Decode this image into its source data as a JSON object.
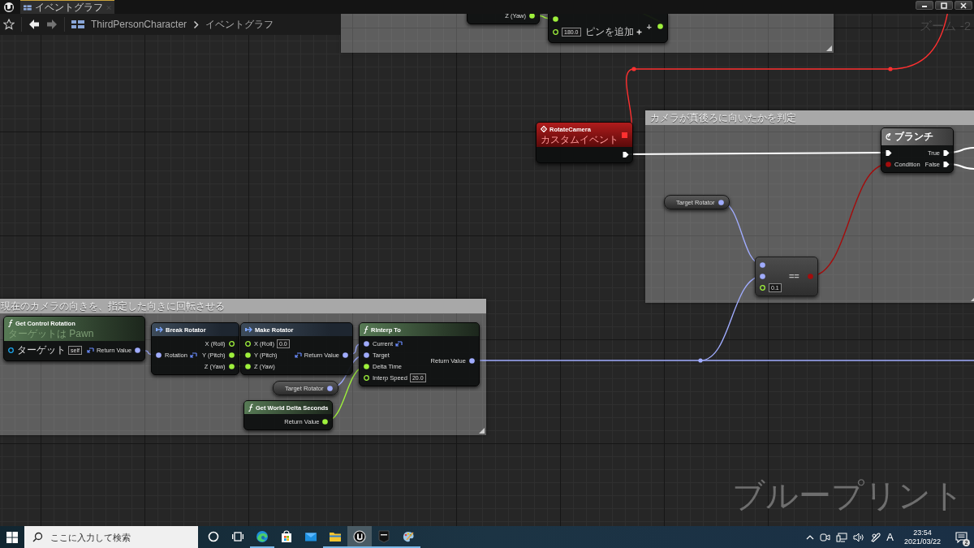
{
  "window": {
    "tab": {
      "title": "イベントグラフ",
      "selected": true
    }
  },
  "toolbar": {
    "nav": [
      {
        "kind": "back",
        "disabled": false
      },
      {
        "kind": "forward",
        "disabled": true
      }
    ],
    "breadcrumb": [
      {
        "label": "ThirdPersonCharacter"
      },
      {
        "label": "イベントグラフ"
      }
    ]
  },
  "graph": {
    "zoom_label": "ズーム -2",
    "watermark": "ブループリント",
    "comments": [
      {
        "kind": "plain"
      },
      {
        "kind": "titled",
        "title": "カメラが真後ろに向いたかを判定"
      },
      {
        "kind": "titled",
        "title": "現在のカメラの向きを、指定した向きに回転させる"
      }
    ],
    "nodes": [
      {
        "kind": "partial",
        "outputs": [
          {
            "label": "Z (Yaw)",
            "kind": "float",
            "connected": true
          }
        ]
      },
      {
        "kind": "partial",
        "symbol": "+",
        "add_pin": "ピンを追加",
        "inputs": [
          {
            "kind": "float",
            "connected": true
          },
          {
            "kind": "float",
            "connected": false,
            "value": "180.0"
          }
        ],
        "outputs": [
          {
            "kind": "float",
            "connected": true
          }
        ]
      },
      {
        "kind": "event",
        "title": "RotateCamera",
        "subtitle": "カスタムイベント",
        "outputs": [
          {
            "kind": "delegate",
            "connected": true
          },
          {
            "kind": "exec",
            "connected": true
          }
        ]
      },
      {
        "kind": "branch",
        "title": "ブランチ",
        "inputs": [
          {
            "kind": "exec",
            "connected": true
          },
          {
            "label": "Condition",
            "kind": "bool",
            "connected": true
          }
        ],
        "outputs": [
          {
            "label": "True",
            "kind": "exec",
            "connected": true
          },
          {
            "label": "False",
            "kind": "exec",
            "connected": true
          }
        ]
      },
      {
        "kind": "variable",
        "outputs": [
          {
            "label": "Target Rotator",
            "kind": "rotator",
            "connected": true
          }
        ]
      },
      {
        "kind": "operator",
        "symbol": "==",
        "inputs": [
          {
            "kind": "rotator",
            "connected": true
          },
          {
            "kind": "rotator",
            "connected": true
          },
          {
            "kind": "float",
            "connected": false,
            "value": "0.1"
          }
        ],
        "outputs": [
          {
            "kind": "bool",
            "connected": true
          }
        ]
      },
      {
        "kind": "function",
        "title": "Get Control Rotation",
        "subtitle": "ターゲットは Pawn",
        "inputs": [
          {
            "label": "ターゲット",
            "kind": "object",
            "connected": false,
            "value": "self"
          }
        ],
        "outputs": [
          {
            "label": "Return Value",
            "kind": "rotator",
            "connected": true,
            "split": true
          }
        ]
      },
      {
        "kind": "struct",
        "title": "Break Rotator",
        "inputs": [
          {
            "label": "Rotation",
            "kind": "rotator",
            "connected": true,
            "split": true
          }
        ],
        "outputs": [
          {
            "label": "X (Roll)",
            "kind": "float",
            "connected": false
          },
          {
            "label": "Y (Pitch)",
            "kind": "float",
            "connected": true
          },
          {
            "label": "Z (Yaw)",
            "kind": "float",
            "connected": true
          }
        ]
      },
      {
        "kind": "struct",
        "title": "Make Rotator",
        "inputs": [
          {
            "label": "X (Roll)",
            "kind": "float",
            "connected": false,
            "value": "0.0"
          },
          {
            "label": "Y (Pitch)",
            "kind": "float",
            "connected": true
          },
          {
            "label": "Z (Yaw)",
            "kind": "float",
            "connected": true
          }
        ],
        "outputs": [
          {
            "label": "Return Value",
            "kind": "rotator",
            "connected": true,
            "split": true
          }
        ]
      },
      {
        "kind": "function",
        "title": "RInterp To",
        "inputs": [
          {
            "label": "Current",
            "kind": "rotator",
            "connected": true,
            "split": true
          },
          {
            "label": "Target",
            "kind": "rotator",
            "connected": true
          },
          {
            "label": "Delta Time",
            "kind": "float",
            "connected": true
          },
          {
            "label": "Interp Speed",
            "kind": "float",
            "connected": false,
            "value": "20.0"
          }
        ],
        "outputs": [
          {
            "label": "Return Value",
            "kind": "rotator",
            "connected": true
          }
        ]
      },
      {
        "kind": "variable",
        "outputs": [
          {
            "label": "Target Rotator",
            "kind": "rotator",
            "connected": true
          }
        ]
      },
      {
        "kind": "function",
        "title": "Get World Delta Seconds",
        "outputs": [
          {
            "label": "Return Value",
            "kind": "float",
            "connected": true
          }
        ]
      }
    ]
  },
  "taskbar": {
    "search": {
      "placeholder": "ここに入力して検索"
    },
    "apps": [
      {
        "kind": "cortana",
        "running": false,
        "selected": false
      },
      {
        "kind": "task-view",
        "running": false,
        "selected": false
      },
      {
        "kind": "browser",
        "running": true,
        "selected": false
      },
      {
        "kind": "store",
        "running": false,
        "selected": false
      },
      {
        "kind": "mail",
        "running": false,
        "selected": false
      },
      {
        "kind": "folder",
        "running": true,
        "selected": false
      },
      {
        "kind": "unreal",
        "running": true,
        "selected": true
      },
      {
        "kind": "epic",
        "running": true,
        "selected": false
      },
      {
        "kind": "paint",
        "running": true,
        "selected": false
      }
    ],
    "tray": {
      "ime": "A",
      "time": "23:54",
      "date": "2021/03/22",
      "notifications": "2"
    }
  }
}
